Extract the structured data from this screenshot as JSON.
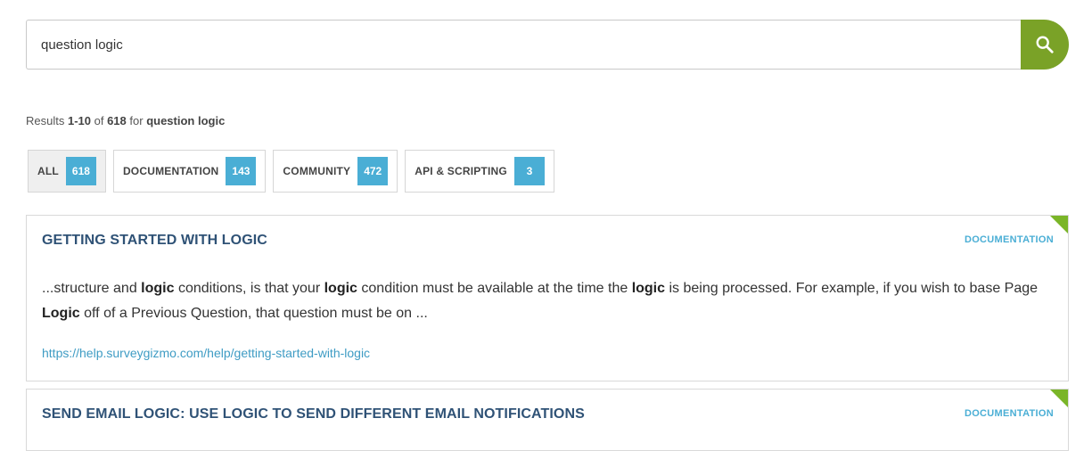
{
  "search": {
    "value": "question logic",
    "button_icon": "search-icon"
  },
  "summary": {
    "prefix": "Results ",
    "range": "1-10",
    "of_text": " of ",
    "total": "618",
    "for_text": " for ",
    "query": "question logic"
  },
  "filters": [
    {
      "label": "ALL",
      "count": "618",
      "active": true
    },
    {
      "label": "DOCUMENTATION",
      "count": "143",
      "active": false
    },
    {
      "label": "COMMUNITY",
      "count": "472",
      "active": false
    },
    {
      "label": "API & SCRIPTING",
      "count": "3",
      "active": false
    }
  ],
  "results": [
    {
      "title": "GETTING STARTED WITH LOGIC",
      "type": "DOCUMENTATION",
      "snippet": [
        {
          "t": "...structure and "
        },
        {
          "t": "logic",
          "b": true
        },
        {
          "t": " conditions, is that your "
        },
        {
          "t": "logic",
          "b": true
        },
        {
          "t": " condition must be available at the time the "
        },
        {
          "t": "logic",
          "b": true
        },
        {
          "t": " is being processed. For example, if you wish to base Page "
        },
        {
          "t": "Logic",
          "b": true
        },
        {
          "t": " off of a Previous Question, that question must be on ..."
        }
      ],
      "url": "https://help.surveygizmo.com/help/getting-started-with-logic"
    },
    {
      "title": "SEND EMAIL LOGIC: USE LOGIC TO SEND DIFFERENT EMAIL NOTIFICATIONS",
      "type": "DOCUMENTATION"
    }
  ],
  "colors": {
    "accent_green": "#7aa227",
    "count_blue": "#4aaed5",
    "title_navy": "#2f5276",
    "corner_green": "#7ab528"
  }
}
